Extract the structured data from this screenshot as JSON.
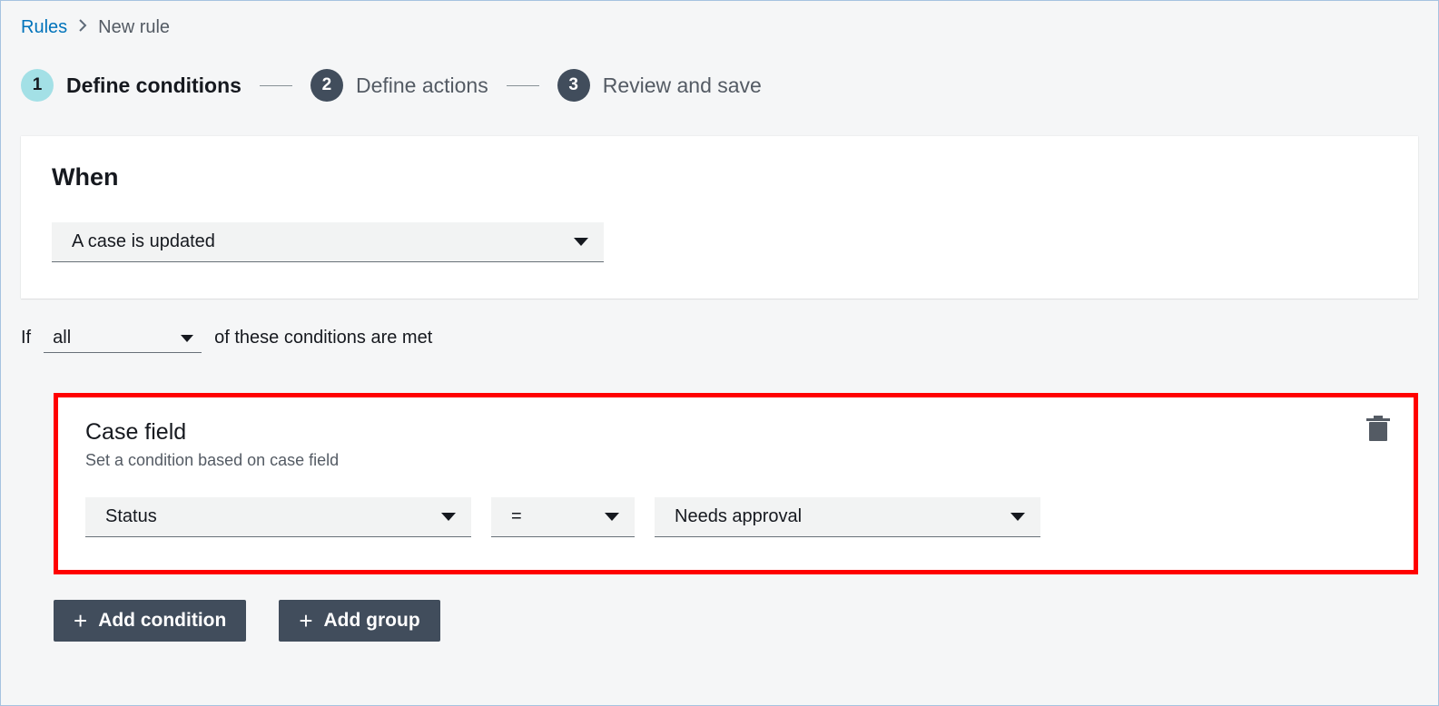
{
  "breadcrumb": {
    "root": "Rules",
    "current": "New rule"
  },
  "wizard": {
    "steps": [
      {
        "num": "1",
        "label": "Define conditions"
      },
      {
        "num": "2",
        "label": "Define actions"
      },
      {
        "num": "3",
        "label": "Review and save"
      }
    ]
  },
  "when": {
    "heading": "When",
    "trigger": "A case is updated"
  },
  "ifclause": {
    "prefix": "If",
    "mode": "all",
    "suffix": "of these conditions are met"
  },
  "condition": {
    "title": "Case field",
    "subtitle": "Set a condition based on case field",
    "field": "Status",
    "operator": "=",
    "value": "Needs approval"
  },
  "buttons": {
    "add_condition": "Add condition",
    "add_group": "Add group"
  }
}
